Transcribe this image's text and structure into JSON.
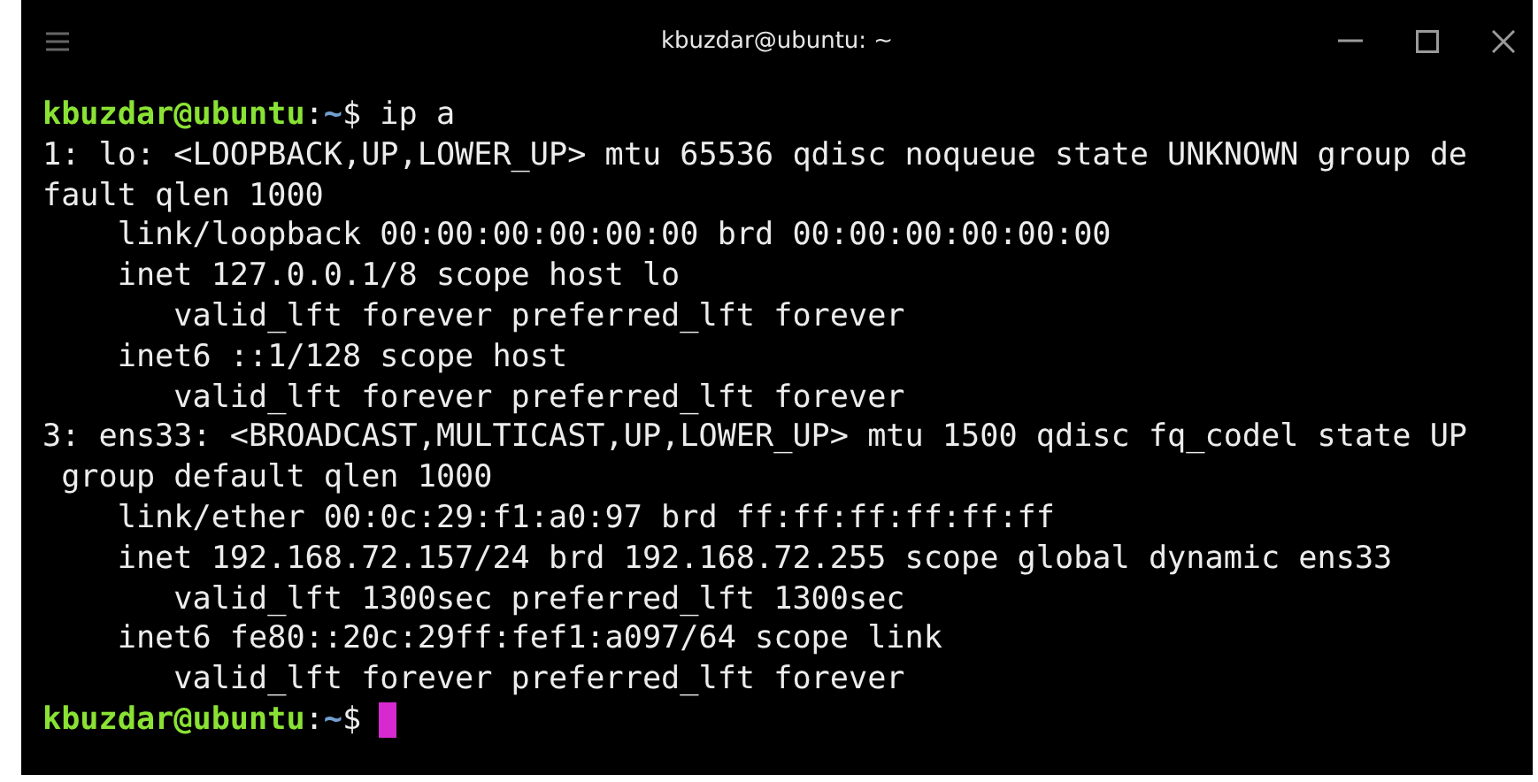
{
  "window": {
    "title": "kbuzdar@ubuntu: ~"
  },
  "terminal": {
    "lines": [
      {
        "kind": "prompt",
        "user": "kbuzdar@ubuntu",
        "separator": ":",
        "path": "~",
        "symbol": "$",
        "command": "ip a",
        "cursor": false
      },
      {
        "kind": "output",
        "text": "1: lo: <LOOPBACK,UP,LOWER_UP> mtu 65536 qdisc noqueue state UNKNOWN group de"
      },
      {
        "kind": "output",
        "text": "fault qlen 1000"
      },
      {
        "kind": "output",
        "text": "    link/loopback 00:00:00:00:00:00 brd 00:00:00:00:00:00"
      },
      {
        "kind": "output",
        "text": "    inet 127.0.0.1/8 scope host lo"
      },
      {
        "kind": "output",
        "text": "       valid_lft forever preferred_lft forever"
      },
      {
        "kind": "output",
        "text": "    inet6 ::1/128 scope host"
      },
      {
        "kind": "output",
        "text": "       valid_lft forever preferred_lft forever"
      },
      {
        "kind": "output",
        "text": "3: ens33: <BROADCAST,MULTICAST,UP,LOWER_UP> mtu 1500 qdisc fq_codel state UP"
      },
      {
        "kind": "output",
        "text": " group default qlen 1000"
      },
      {
        "kind": "output",
        "text": "    link/ether 00:0c:29:f1:a0:97 brd ff:ff:ff:ff:ff:ff"
      },
      {
        "kind": "output",
        "text": "    inet 192.168.72.157/24 brd 192.168.72.255 scope global dynamic ens33"
      },
      {
        "kind": "output",
        "text": "       valid_lft 1300sec preferred_lft 1300sec"
      },
      {
        "kind": "output",
        "text": "    inet6 fe80::20c:29ff:fef1:a097/64 scope link"
      },
      {
        "kind": "output",
        "text": "       valid_lft forever preferred_lft forever"
      },
      {
        "kind": "prompt",
        "user": "kbuzdar@ubuntu",
        "separator": ":",
        "path": "~",
        "symbol": "$",
        "cursor": true
      }
    ]
  }
}
